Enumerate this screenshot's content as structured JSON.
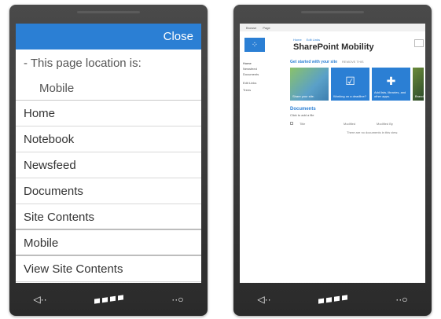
{
  "left_phone": {
    "menu": {
      "close_label": "Close",
      "location_label": "- This page location is:",
      "location_value": "Mobile",
      "items": [
        {
          "label": "Home"
        },
        {
          "label": "Notebook"
        },
        {
          "label": "Newsfeed"
        },
        {
          "label": "Documents"
        },
        {
          "label": "Site Contents"
        },
        {
          "label": "Mobile"
        },
        {
          "label": "View Site Contents"
        }
      ]
    }
  },
  "right_phone": {
    "sharepoint": {
      "top_links": [
        "Browse",
        "Page"
      ],
      "breadcrumb": [
        "Home",
        "Edit Links"
      ],
      "site_title": "SharePoint Mobility",
      "quick_launch": [
        "Home",
        "Newsfeed",
        "Documents",
        "Edit Links",
        "Trees"
      ],
      "get_started": "Get started with your site",
      "remove_this": "REMOVE THIS",
      "tiles": [
        {
          "caption": "Share your site."
        },
        {
          "caption": "Working on a deadline?"
        },
        {
          "caption": "Add lists, libraries, and other apps."
        },
        {
          "caption": "Brand"
        }
      ],
      "documents_heading": "Documents",
      "new_file": "Click to add a file",
      "doc_columns": [
        "Title",
        "Modified",
        "Modified By"
      ],
      "empty_message": "There are no documents in this view."
    }
  },
  "nav_bar": {
    "back_icon": "back-arrow-icon",
    "start_icon": "windows-logo-icon",
    "search_icon": "search-icon"
  }
}
